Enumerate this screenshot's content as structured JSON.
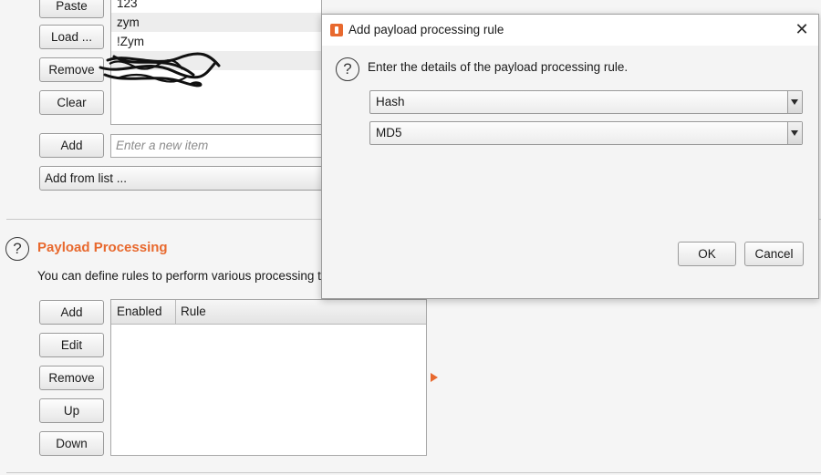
{
  "left_panel": {
    "buttons": {
      "paste": "Paste",
      "load": "Load ...",
      "remove": "Remove",
      "clear": "Clear",
      "add": "Add",
      "add_from_list": "Add from list ..."
    },
    "items": [
      "123",
      "zym",
      "!Zym",
      "",
      ""
    ],
    "new_item_placeholder": "Enter a new item"
  },
  "payload_processing": {
    "title": "Payload Processing",
    "description": "You can define rules to perform various processing tas",
    "buttons": {
      "add": "Add",
      "edit": "Edit",
      "remove": "Remove",
      "up": "Up",
      "down": "Down"
    },
    "table": {
      "columns": [
        "Enabled",
        "Rule"
      ],
      "rows": []
    }
  },
  "dialog": {
    "title": "Add payload processing rule",
    "message": "Enter the details of the payload processing rule.",
    "rule_type": "Hash",
    "hash_algorithm": "MD5",
    "ok_label": "OK",
    "cancel_label": "Cancel",
    "help_glyph": "?",
    "close_glyph": "✕"
  },
  "colors": {
    "accent": "#e8692e",
    "background": "#f5f5f5",
    "dialog_background": "#f4f4f4"
  },
  "icons": [
    "help-icon",
    "burp-logo-icon",
    "close-icon",
    "dropdown-arrow-icon",
    "expand-arrow-icon"
  ]
}
